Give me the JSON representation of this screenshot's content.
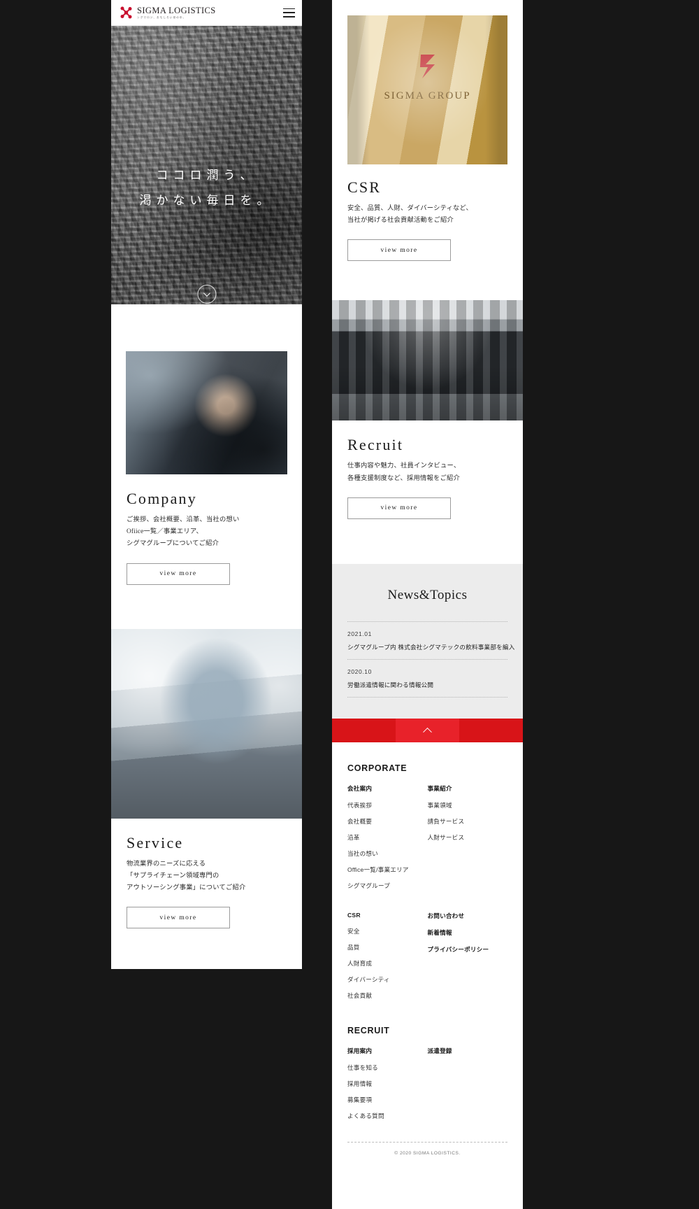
{
  "header": {
    "logo_title": "SIGMA LOGISTICS",
    "logo_sub": "シグマロジ、おもしろい世の中。",
    "logo_icon": "sigma-logo-icon",
    "menu_icon": "hamburger-menu-icon"
  },
  "hero": {
    "line1": "ココロ潤う、",
    "line2": "渇かない毎日を。",
    "scroll_icon": "scroll-down-circle-icon"
  },
  "sections": {
    "company": {
      "title": "Company",
      "desc_lines": [
        "ご挨拶、会社概要、沿革、当社の想い",
        "Ofiice一覧／事業エリア、",
        "シグマグループについてご紹介"
      ],
      "button": "view more",
      "image_name": "female-truck-driver-photo"
    },
    "service": {
      "title": "Service",
      "desc_lines": [
        "物流業界のニーズに応える",
        "「サプライチェーン領域専門の",
        "アウトソーシング事業」についてご紹介"
      ],
      "button": "view more",
      "image_name": "male-staff-with-trucks-photo"
    },
    "csr": {
      "title": "CSR",
      "desc_lines": [
        "安全、品質、人財、ダイバーシティなど、",
        "当社が掲げる社会貢献活動をご紹介"
      ],
      "button": "view more",
      "image_name": "sigma-group-signboard-photo",
      "image_caption": "SIGMA GROUP"
    },
    "recruit": {
      "title": "Recruit",
      "desc_lines": [
        "仕事内容や魅力、社員インタビュー、",
        "各種支援制度など、採用情報をご紹介"
      ],
      "button": "view more",
      "image_name": "recruit-team-photo"
    }
  },
  "news": {
    "title": "News&Topics",
    "items": [
      {
        "date": "2021.01",
        "text": "シグマグループ内 株式会社シグマテックの飲料事業部を編入"
      },
      {
        "date": "2020.10",
        "text": "労働派遣情報に関わる情報公開"
      }
    ]
  },
  "pagetop": {
    "icon": "chevron-up-icon",
    "label": ""
  },
  "footer": {
    "groups": [
      {
        "title": "CORPORATE",
        "columns": [
          {
            "head": "会社案内",
            "links": [
              "代表挨拶",
              "会社概要",
              "沿革",
              "当社の想い",
              "Office一覧/事業エリア",
              "シグマグループ"
            ]
          },
          {
            "head": "事業紹介",
            "links": [
              "事業領域",
              "請負サービス",
              "人財サービス"
            ]
          }
        ]
      },
      {
        "title": "",
        "columns": [
          {
            "head": "CSR",
            "links": [
              "安全",
              "品質",
              "人財育成",
              "ダイバーシティ",
              "社会貢献"
            ]
          },
          {
            "head": "お問い合わせ",
            "links": [
              "新着情報",
              "プライバシーポリシー"
            ]
          }
        ]
      },
      {
        "title": "RECRUIT",
        "columns": [
          {
            "head": "採用案内",
            "links": [
              "仕事を知る",
              "採用情報",
              "募集要項",
              "よくある質問"
            ]
          },
          {
            "head": "派遣登録",
            "links": []
          }
        ]
      }
    ],
    "copyright": "© 2020 SIGMA LOGISTICS."
  },
  "colors": {
    "brand_red": "#d81418",
    "text_dark": "#1b1b1b",
    "news_bg": "#ececec"
  }
}
